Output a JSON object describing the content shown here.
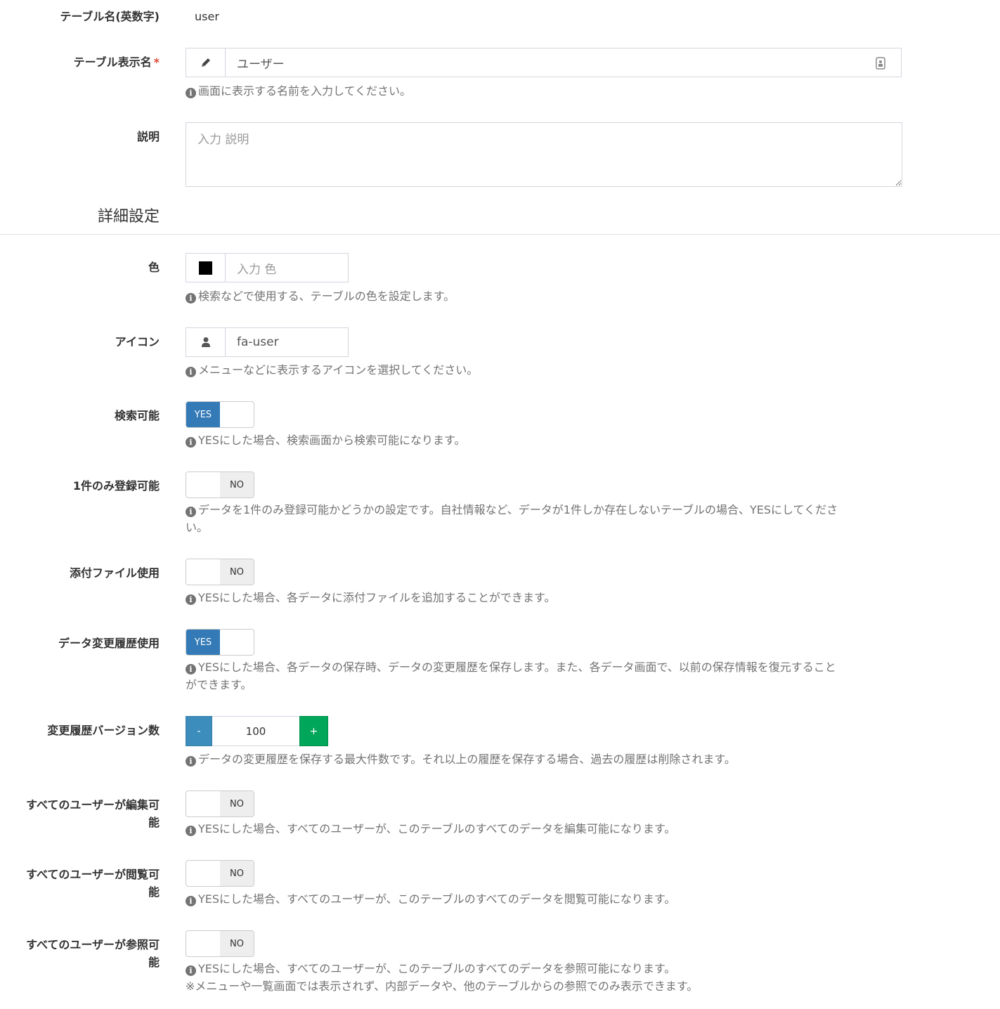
{
  "fields": {
    "table_name": {
      "label": "テーブル名(英数字)",
      "value": "user"
    },
    "display_name": {
      "label": "テーブル表示名",
      "required_mark": "*",
      "value": "ユーザー",
      "help": "画面に表示する名前を入力してください。",
      "addon_icon": "pencil-icon"
    },
    "description": {
      "label": "説明",
      "placeholder": "入力 説明"
    }
  },
  "section_title": "詳細設定",
  "details": {
    "color": {
      "label": "色",
      "placeholder": "入力 色",
      "swatch_color": "#000000",
      "help": "検索などで使用する、テーブルの色を設定します。"
    },
    "icon": {
      "label": "アイコン",
      "value": "fa-user",
      "help": "メニューなどに表示するアイコンを選択してください。",
      "addon_icon": "user-icon"
    },
    "searchable": {
      "label": "検索可能",
      "state": "YES",
      "help": "YESにした場合、検索画面から検索可能になります。"
    },
    "single_record": {
      "label": "1件のみ登録可能",
      "state": "NO",
      "help_line1": "データを1件のみ登録可能かどうかの設定です。自社情報など、データが1件しか存在しないテーブルの場合、YESにしてくださ",
      "help_line2": "い。"
    },
    "attachments": {
      "label": "添付ファイル使用",
      "state": "NO",
      "help": "YESにした場合、各データに添付ファイルを追加することができます。"
    },
    "revision_history": {
      "label": "データ変更履歴使用",
      "state": "YES",
      "help_line1": "YESにした場合、各データの保存時、データの変更履歴を保存します。また、各データ画面で、以前の保存情報を復元すること",
      "help_line2": "ができます。"
    },
    "revision_count": {
      "label": "変更履歴バージョン数",
      "minus_label": "-",
      "plus_label": "+",
      "value": "100",
      "help": "データの変更履歴を保存する最大件数です。それ以上の履歴を保存する場合、過去の履歴は削除されます。"
    },
    "all_edit": {
      "label_line1": "すべてのユーザーが編集可",
      "label_line2": "能",
      "state": "NO",
      "help": "YESにした場合、すべてのユーザーが、このテーブルのすべてのデータを編集可能になります。"
    },
    "all_view": {
      "label_line1": "すべてのユーザーが閲覧可",
      "label_line2": "能",
      "state": "NO",
      "help": "YESにした場合、すべてのユーザーが、このテーブルのすべてのデータを閲覧可能になります。"
    },
    "all_reference": {
      "label_line1": "すべてのユーザーが参照可",
      "label_line2": "能",
      "state": "NO",
      "help_line1": "YESにした場合、すべてのユーザーが、このテーブルのすべてのデータを参照可能になります。",
      "help_line2": "※メニューや一覧画面では表示されず、内部データや、他のテーブルからの参照でのみ表示できます。"
    }
  },
  "colors": {
    "yes_toggle": "#337ab7",
    "no_toggle": "#eeeeee",
    "minus_button": "#3c8dbc",
    "plus_button": "#00a65a",
    "required": "#dd4b39"
  }
}
